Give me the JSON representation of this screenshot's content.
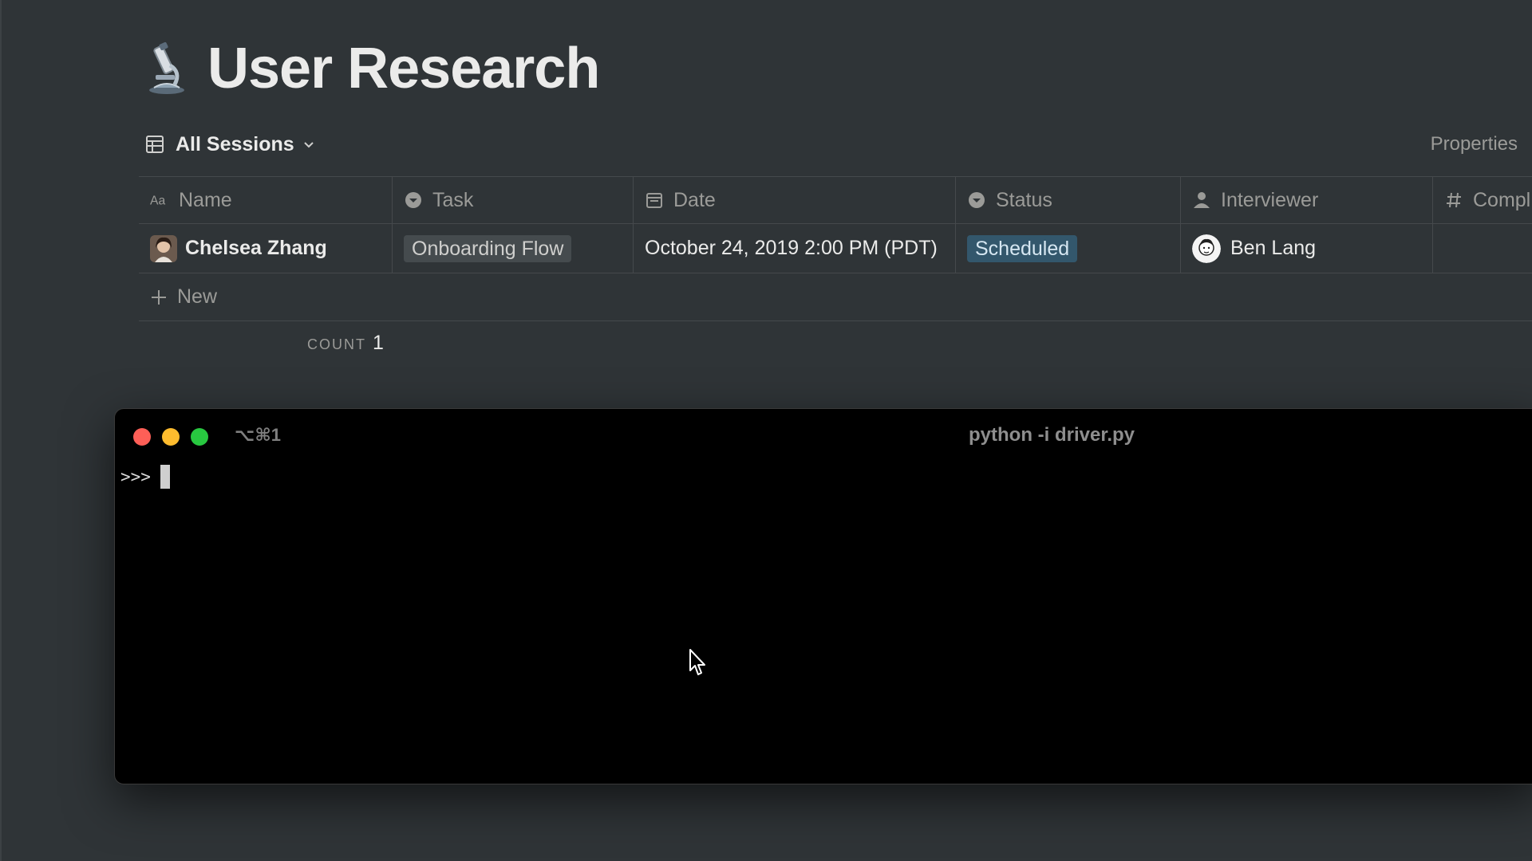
{
  "page": {
    "title": "User Research",
    "emoji": "microscope-icon"
  },
  "view": {
    "label": "All Sessions",
    "properties_label": "Properties"
  },
  "table": {
    "columns": [
      {
        "label": "Name",
        "icon": "text-icon"
      },
      {
        "label": "Task",
        "icon": "select-icon"
      },
      {
        "label": "Date",
        "icon": "calendar-icon"
      },
      {
        "label": "Status",
        "icon": "select-icon"
      },
      {
        "label": "Interviewer",
        "icon": "person-icon"
      },
      {
        "label": "Compl",
        "icon": "number-icon"
      }
    ],
    "rows": [
      {
        "name": "Chelsea Zhang",
        "task": "Onboarding Flow",
        "date": "October 24, 2019 2:00 PM (PDT)",
        "status": "Scheduled",
        "interviewer": "Ben Lang"
      }
    ],
    "new_label": "New",
    "count_label": "COUNT",
    "count_value": "1"
  },
  "terminal": {
    "shortcut": "⌥⌘1",
    "title": "python -i driver.py",
    "prompt": ">>>"
  },
  "colors": {
    "background": "#2f3437",
    "tag_gray": "#454b4e",
    "tag_blue": "#33576c",
    "close": "#fe5f57",
    "minimize": "#febc2e",
    "zoom": "#28c840"
  }
}
